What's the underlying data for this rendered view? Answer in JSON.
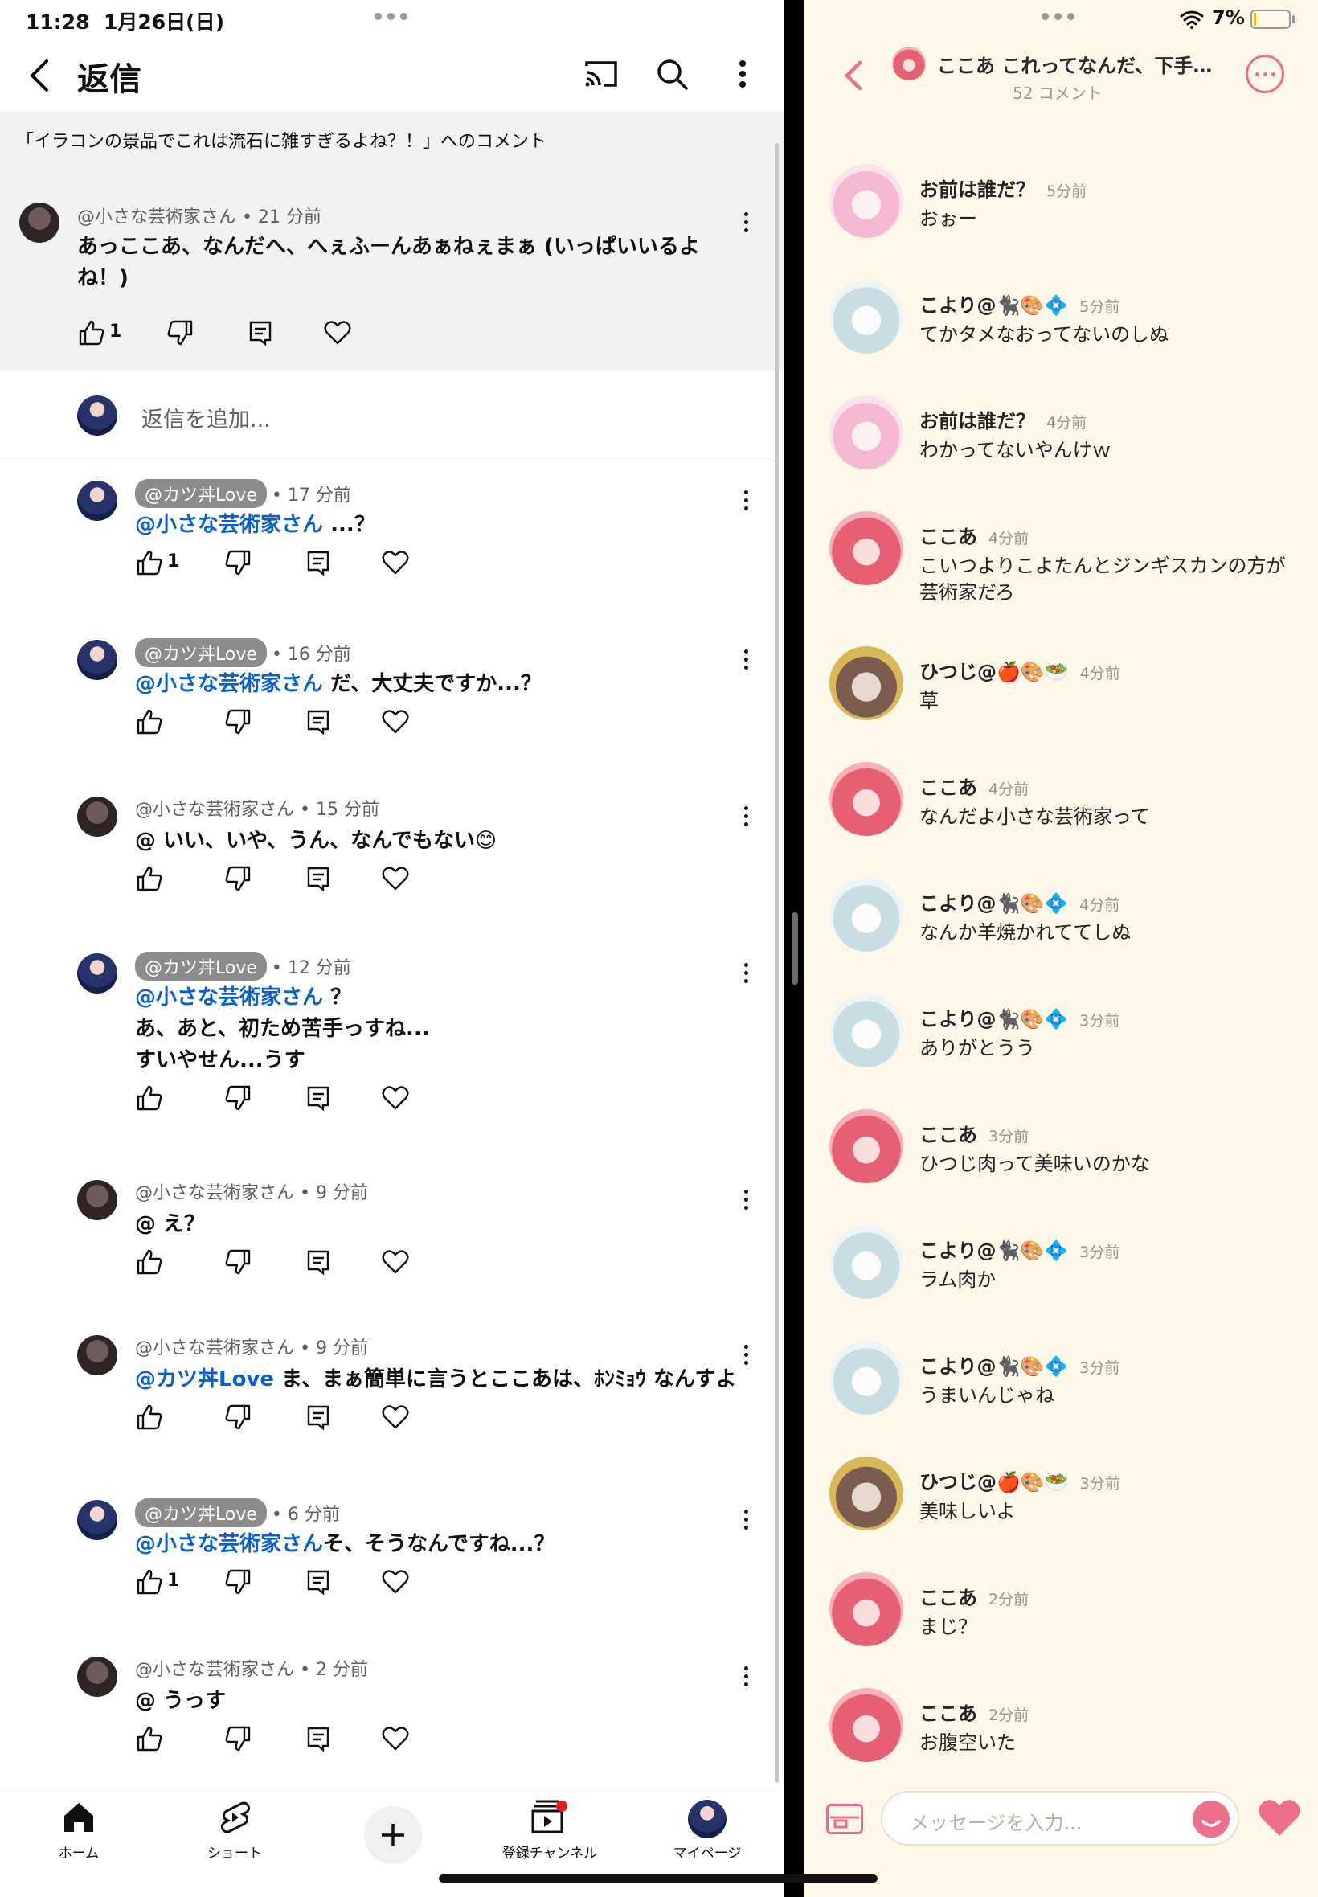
{
  "status_left": {
    "time": "11:28",
    "date": "1月26日(日)"
  },
  "status_right": {
    "battery_pct": "7%",
    "battery_level": 0.07
  },
  "yt": {
    "title": "返信",
    "context": "「イラコンの景品でこれは流石に雑すぎるよね？！」へのコメント",
    "parent": {
      "author": "@小さな芸術家さん",
      "time": "21 分前",
      "text": "あっここあ、なんだへ、へぇふーんあぁねぇまぁ (いっぱいいるよね！)",
      "likes": "1"
    },
    "add_reply_placeholder": "返信を追加...",
    "replies": [
      {
        "author": "@カツ丼Love",
        "owner": true,
        "time": "17 分前",
        "mention": "@小さな芸術家さん",
        "text": " ...？",
        "likes": "1"
      },
      {
        "author": "@カツ丼Love",
        "owner": true,
        "time": "16 分前",
        "mention": "@小さな芸術家さん",
        "text": " だ、大丈夫ですか...？",
        "likes": ""
      },
      {
        "author": "@小さな芸術家さん",
        "owner": false,
        "time": "15 分前",
        "mention": "",
        "text": "@ いい、いや、うん、なんでもない😊",
        "likes": ""
      },
      {
        "author": "@カツ丼Love",
        "owner": true,
        "time": "12 分前",
        "mention": "@小さな芸術家さん",
        "text": " ？\nあ、あと、初ため苦手っすね...\nすいやせん...うす",
        "likes": ""
      },
      {
        "author": "@小さな芸術家さん",
        "owner": false,
        "time": "9 分前",
        "mention": "",
        "text": "@ え？",
        "likes": ""
      },
      {
        "author": "@小さな芸術家さん",
        "owner": false,
        "time": "9 分前",
        "mention": "@カツ丼Love",
        "text": " ま、まぁ簡単に言うとここあは、ﾎﾝﾐｮｳ なんすよ",
        "likes": ""
      },
      {
        "author": "@カツ丼Love",
        "owner": true,
        "time": "6 分前",
        "mention": "@小さな芸術家さん",
        "text": "そ、そうなんですね...？",
        "likes": "1"
      },
      {
        "author": "@小さな芸術家さん",
        "owner": false,
        "time": "2 分前",
        "mention": "",
        "text": "@ うっす",
        "likes": ""
      }
    ],
    "nav": [
      {
        "label": "ホーム",
        "icon": "home-icon"
      },
      {
        "label": "ショート",
        "icon": "shorts-icon"
      },
      {
        "label": "",
        "icon": "plus-icon"
      },
      {
        "label": "登録チャンネル",
        "icon": "subscriptions-icon"
      },
      {
        "label": "マイページ",
        "icon": "avatar"
      }
    ]
  },
  "chat": {
    "title": "ここあ これってなんだ、下手…",
    "subtitle": "52 コメント",
    "input_placeholder": "メッセージを入力...",
    "messages": [
      {
        "name": "お前は誰だ？",
        "time": "5分前",
        "text": "おぉー",
        "avatar": "pink"
      },
      {
        "name": "こより@🐈‍⬛🎨💠",
        "time": "5分前",
        "text": "てかタメなおってないのしぬ",
        "avatar": "silver"
      },
      {
        "name": "お前は誰だ？",
        "time": "4分前",
        "text": "わかってないやんけｗ",
        "avatar": "pink"
      },
      {
        "name": "ここあ",
        "time": "4分前",
        "text": "こいつよりこよたんとジンギスカンの方が芸術家だろ",
        "avatar": "red"
      },
      {
        "name": "ひつじ@🍎🎨🥗",
        "time": "4分前",
        "text": "草",
        "avatar": "frame"
      },
      {
        "name": "ここあ",
        "time": "4分前",
        "text": "なんだよ小さな芸術家って",
        "avatar": "red"
      },
      {
        "name": "こより@🐈‍⬛🎨💠",
        "time": "4分前",
        "text": "なんか羊焼かれててしぬ",
        "avatar": "silver"
      },
      {
        "name": "こより@🐈‍⬛🎨💠",
        "time": "3分前",
        "text": "ありがとうう",
        "avatar": "silver"
      },
      {
        "name": "ここあ",
        "time": "3分前",
        "text": "ひつじ肉って美味いのかな",
        "avatar": "red"
      },
      {
        "name": "こより@🐈‍⬛🎨💠",
        "time": "3分前",
        "text": "ラム肉か",
        "avatar": "silver"
      },
      {
        "name": "こより@🐈‍⬛🎨💠",
        "time": "3分前",
        "text": "うまいんじゃね",
        "avatar": "silver"
      },
      {
        "name": "ひつじ@🍎🎨🥗",
        "time": "3分前",
        "text": "美味しいよ",
        "avatar": "frame"
      },
      {
        "name": "ここあ",
        "time": "2分前",
        "text": "まじ？",
        "avatar": "red"
      },
      {
        "name": "ここあ",
        "time": "2分前",
        "text": "お腹空いた",
        "avatar": "red"
      }
    ]
  },
  "colors": {
    "mention": "#065fd4",
    "accent_pink": "#ee6f8a",
    "chat_bg": "#fdf8ea"
  }
}
